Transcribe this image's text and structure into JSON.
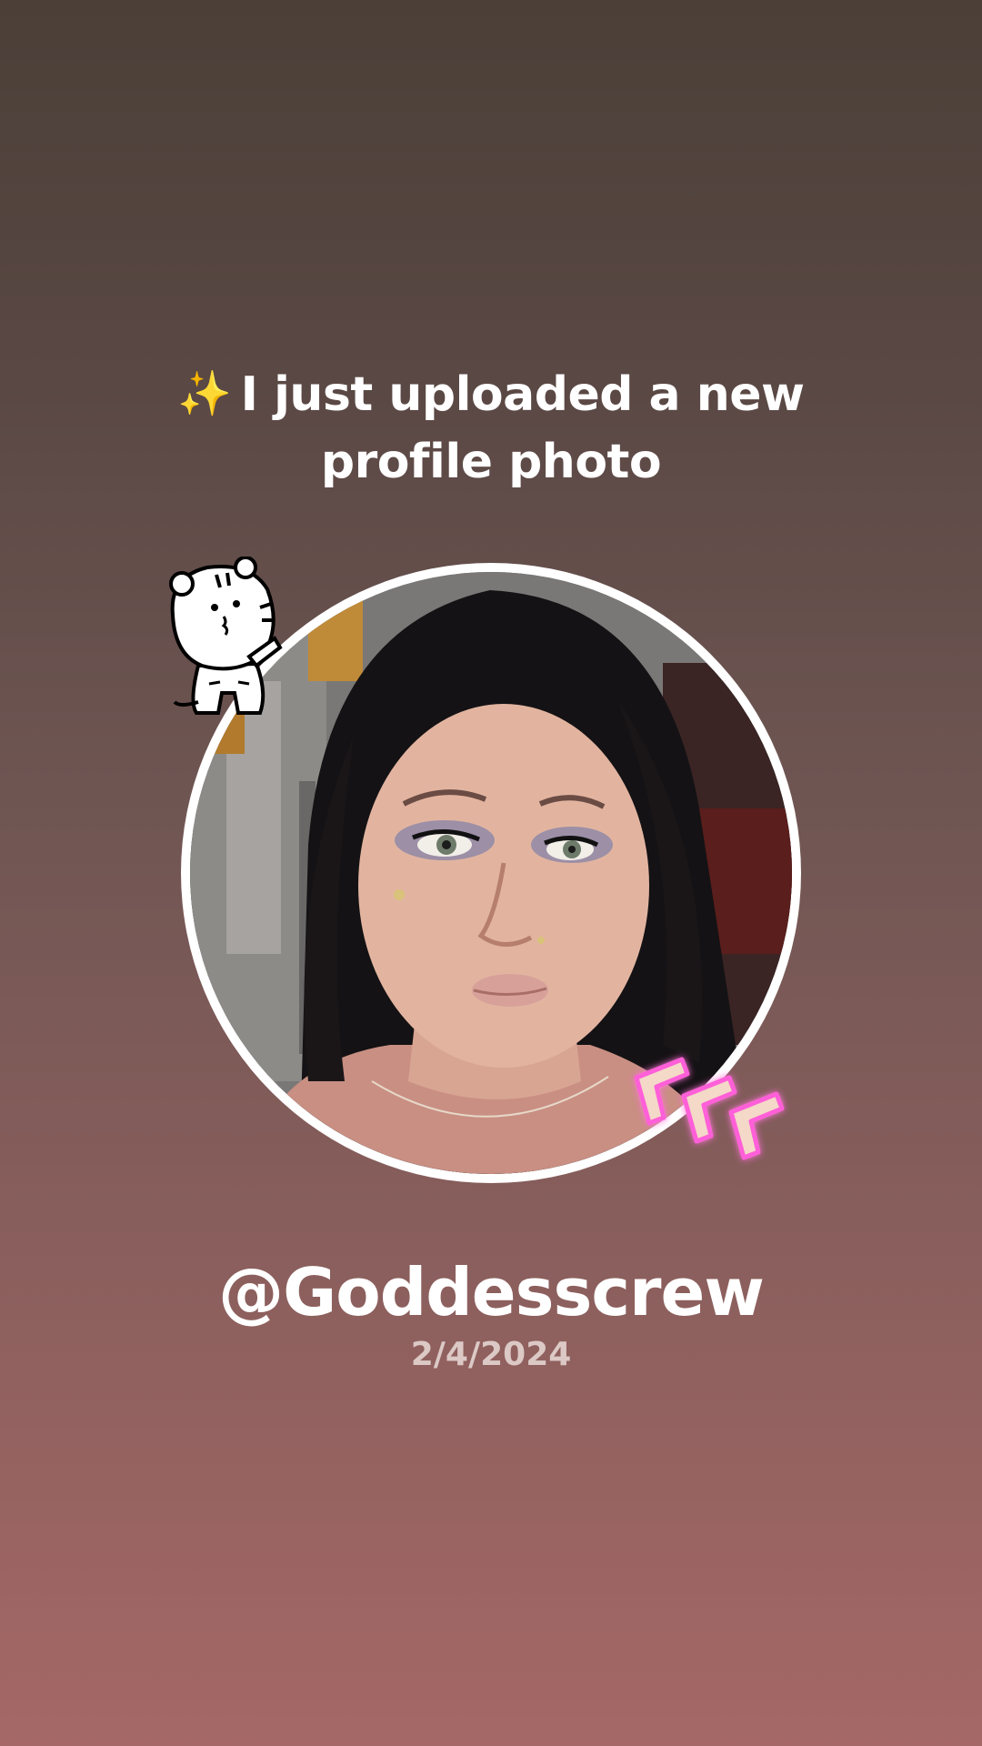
{
  "post": {
    "sparkle_icon": "✨",
    "headline_line1": "I just uploaded a new",
    "headline_line2": "profile photo",
    "username": "@Goddesscrew",
    "date": "2/4/2024"
  },
  "stickers": {
    "top_left": "tiger-cartoon-sticker",
    "bottom_right": "neon-chevron-arrows-sticker"
  },
  "colors": {
    "background_top": "#4b3f38",
    "background_bottom": "#a56866",
    "text_primary": "#ffffff",
    "text_secondary": "#dcc9c6",
    "avatar_ring": "#ffffff",
    "neon_accent": "#ff5fd8"
  }
}
